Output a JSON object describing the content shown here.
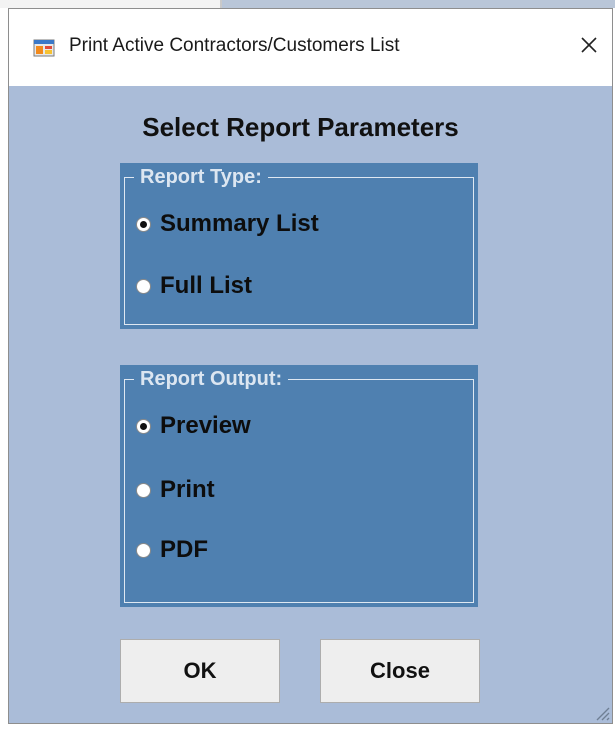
{
  "window": {
    "title": "Print Active Contractors/Customers List",
    "app_icon": "form-icon",
    "close_glyph": "✕"
  },
  "dialog": {
    "heading": "Select Report Parameters"
  },
  "report_type": {
    "legend": "Report Type:",
    "options": [
      {
        "label": "Summary List",
        "checked": true
      },
      {
        "label": "Full List",
        "checked": false
      }
    ]
  },
  "report_output": {
    "legend": "Report Output:",
    "options": [
      {
        "label": "Preview",
        "checked": true
      },
      {
        "label": "Print",
        "checked": false
      },
      {
        "label": "PDF",
        "checked": false
      }
    ]
  },
  "buttons": {
    "ok_label": "OK",
    "close_label": "Close"
  },
  "colors": {
    "dialog_background": "#aabcd8",
    "group_background": "#4f80b0",
    "legend_text": "#dce6f1",
    "button_face": "#eeeeee"
  }
}
